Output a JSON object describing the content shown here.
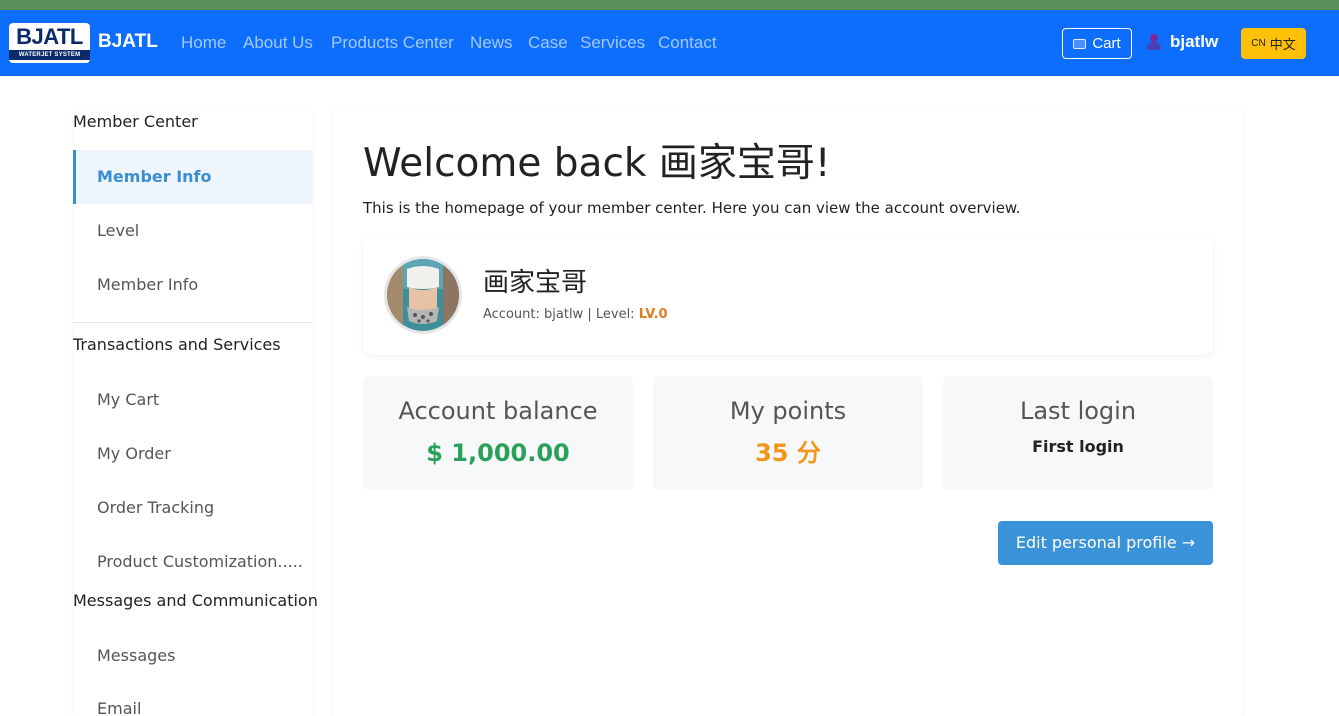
{
  "header": {
    "logo_text": "BJATL",
    "logo_subtext": "WATERJET SYSTEM",
    "brand": "BJATL",
    "nav": [
      "Home",
      "About Us",
      "Products Center",
      "News",
      "Case",
      "Services",
      "Contact"
    ],
    "cart_label": "Cart",
    "cart_icon": "cart-icon",
    "user_icon": "user-icon",
    "username": "bjatlw",
    "lang_code": "CN",
    "lang_label": "中文",
    "colors": {
      "navbar": "#0d6efd",
      "top_strip": "#5b8f5a",
      "lang_button": "#ffc107"
    }
  },
  "sidebar": {
    "groups": [
      {
        "title": "Member Center",
        "items": [
          "Member Info",
          "Level",
          "Member Info"
        ]
      },
      {
        "title": "Transactions and Services",
        "items": [
          "My Cart",
          "My Order",
          "Order Tracking",
          "Product Customization....."
        ]
      },
      {
        "title": "Messages and Communication",
        "items": [
          "Messages",
          "Email"
        ]
      }
    ],
    "active_item": "Member Info",
    "accent_color": "#3a8fd4"
  },
  "main": {
    "welcome": "Welcome back 画家宝哥!",
    "subtitle": "This is the homepage of your member center. Here you can view the account overview.",
    "profile": {
      "name": "画家宝哥",
      "account_label": "Account:",
      "account": "bjatlw",
      "separator": "|",
      "level_label": "Level:",
      "level": "LV.0"
    },
    "stats": [
      {
        "title": "Account balance",
        "value": "$ 1,000.00",
        "color": "#2aa05a"
      },
      {
        "title": "My points",
        "value": "35 分",
        "color": "#f0961b"
      },
      {
        "title": "Last login",
        "value": "First login",
        "color": "#222222"
      }
    ],
    "edit_button": "Edit personal profile →",
    "edit_button_color": "#3a93d8"
  }
}
